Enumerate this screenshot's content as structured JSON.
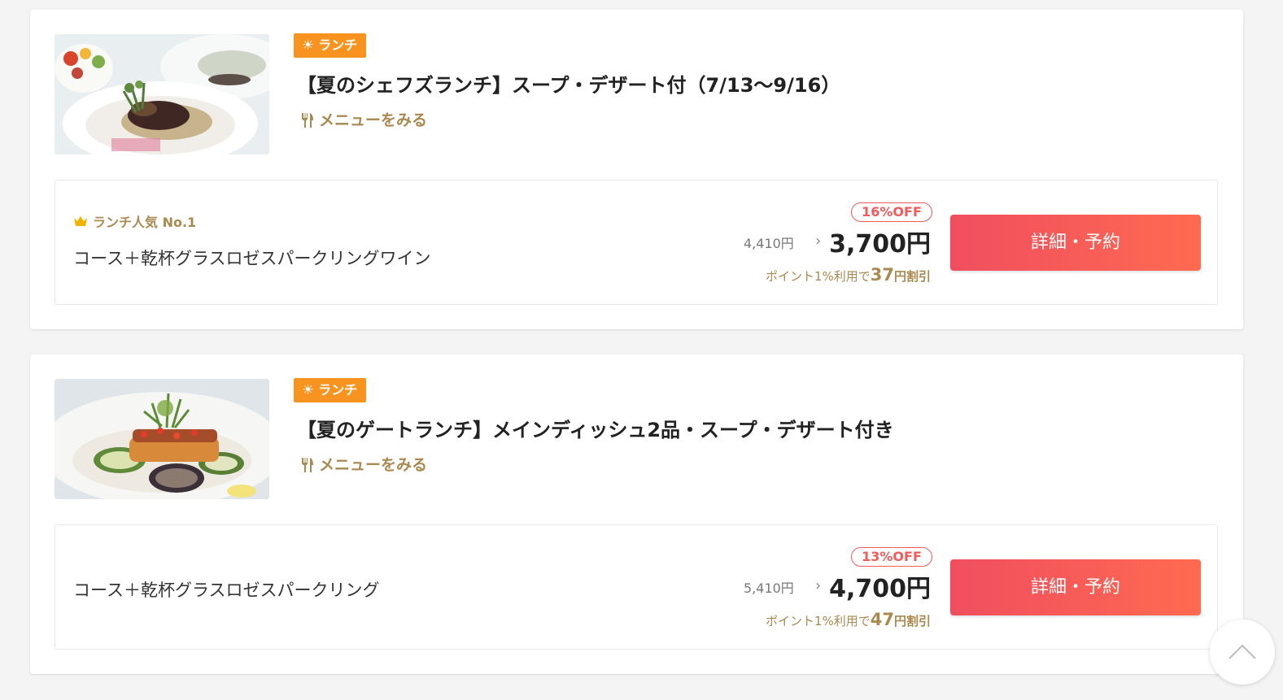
{
  "plans": [
    {
      "category": "ランチ",
      "title": "【夏のシェフズランチ】スープ・デザート付（7/13～9/16）",
      "menu_link": "メニューをみる",
      "popular": "ランチ人気 No.1",
      "course": "コース＋乾杯グラスロゼスパークリングワイン",
      "discount": "16%OFF",
      "original_price": "4,410円",
      "price": "3,700円",
      "points_prefix": "ポイント1%利用で",
      "points_amount": "37",
      "points_suffix": "円割引",
      "button": "詳細・予約"
    },
    {
      "category": "ランチ",
      "title": "【夏のゲートランチ】メインディッシュ2品・スープ・デザート付き",
      "menu_link": "メニューをみる",
      "course": "コース＋乾杯グラスロゼスパークリング",
      "discount": "13%OFF",
      "original_price": "5,410円",
      "price": "4,700円",
      "points_prefix": "ポイント1%利用で",
      "points_amount": "47",
      "points_suffix": "円割引",
      "button": "詳細・予約"
    }
  ],
  "icons": {
    "category": "sun-icon",
    "menu": "fork-knife-icon",
    "popular": "crown-icon",
    "scroll": "chevron-up-icon"
  },
  "colors": {
    "badge": "#f7931e",
    "gold": "#a8894f",
    "button_start": "#f04e5f",
    "button_end": "#ff6a50",
    "discount": "#f05a5a"
  }
}
